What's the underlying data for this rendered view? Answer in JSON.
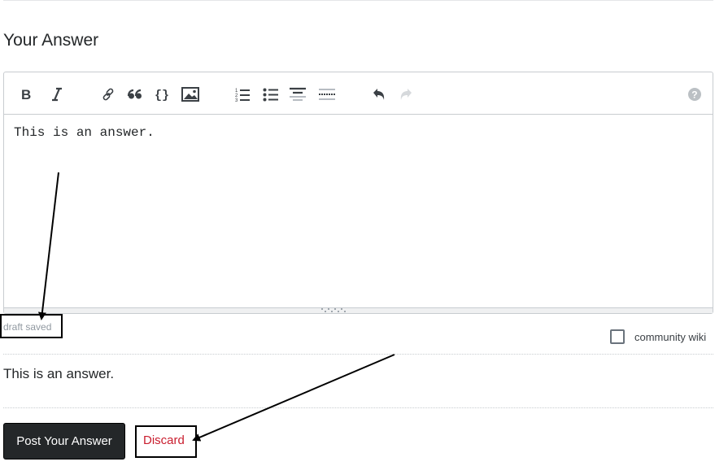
{
  "heading": "Your Answer",
  "toolbar": {
    "buttons": [
      {
        "name": "bold",
        "title": "Bold"
      },
      {
        "name": "italic",
        "title": "Italic"
      },
      {
        "name": "link",
        "title": "Hyperlink"
      },
      {
        "name": "blockquote",
        "title": "Blockquote"
      },
      {
        "name": "code",
        "title": "Code Sample"
      },
      {
        "name": "image",
        "title": "Image"
      },
      {
        "name": "ordered-list",
        "title": "Numbered List"
      },
      {
        "name": "unordered-list",
        "title": "Bulleted List"
      },
      {
        "name": "heading",
        "title": "Heading"
      },
      {
        "name": "horizontal-rule",
        "title": "Horizontal Rule"
      },
      {
        "name": "undo",
        "title": "Undo"
      },
      {
        "name": "redo",
        "title": "Redo"
      },
      {
        "name": "help",
        "title": "Markdown Editing Help"
      }
    ]
  },
  "editor": {
    "value": "This is an answer."
  },
  "draft_status": "draft saved",
  "community_wiki": {
    "label": "community wiki",
    "checked": false
  },
  "preview": {
    "text": "This is an answer."
  },
  "actions": {
    "post_label": "Post Your Answer",
    "discard_label": "Discard"
  },
  "colors": {
    "post_button_bg": "#242729",
    "discard_text": "#c91d2e",
    "draft_text": "#9199a1",
    "border": "#c8ccd0"
  }
}
